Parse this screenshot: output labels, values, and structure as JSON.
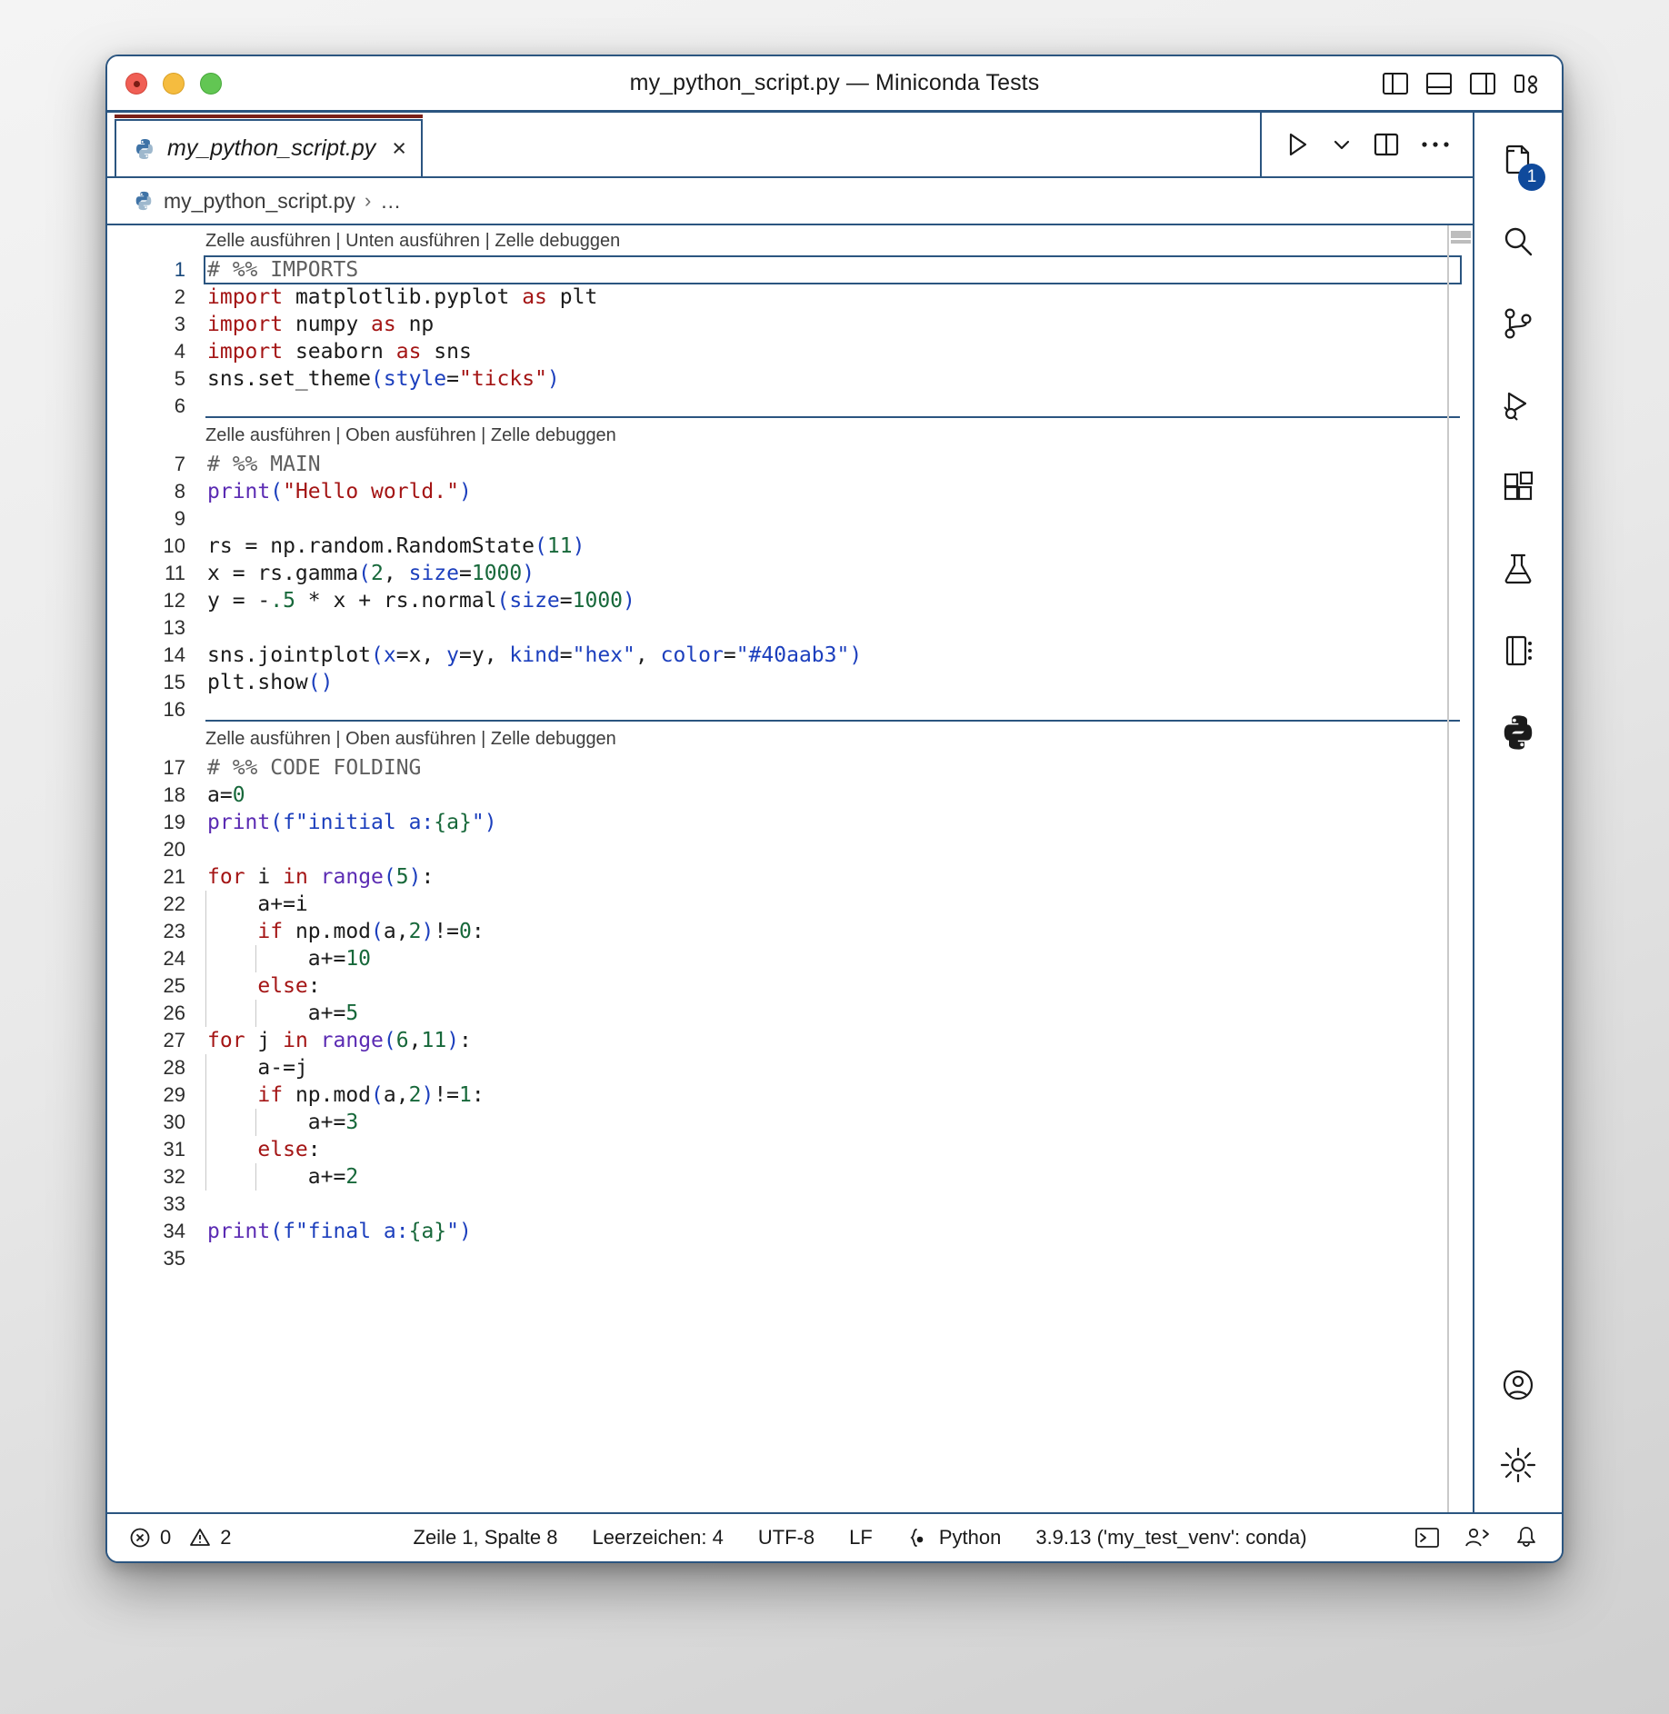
{
  "window": {
    "title": "my_python_script.py — Miniconda Tests",
    "traffic_lights": [
      "close-red",
      "minimize-yellow",
      "maximize-green"
    ],
    "layout_icons": [
      "toggle-primary-sidebar-icon",
      "toggle-panel-icon",
      "toggle-secondary-sidebar-icon",
      "customize-layout-icon"
    ]
  },
  "tab": {
    "label": "my_python_script.py",
    "icon": "python-file-icon",
    "close": "×"
  },
  "tab_actions": {
    "run": "run-python-file-icon",
    "run_dropdown": "chevron-down-icon",
    "split": "split-editor-right-icon",
    "more": "more-actions-icon"
  },
  "breadcrumb": {
    "icon": "python-file-icon",
    "file": "my_python_script.py",
    "separator": "›",
    "tail": "…"
  },
  "codelens": {
    "cell_top": "Zelle ausführen | Unten ausführen | Zelle debuggen",
    "cell_mid": "Zelle ausführen | Oben ausführen | Zelle debuggen",
    "cell_fold": "Zelle ausführen | Oben ausführen | Zelle debuggen"
  },
  "editor": {
    "active_line": 1,
    "lines": [
      {
        "n": 1,
        "tokens": [
          {
            "t": "# %% IMPORTS",
            "c": "cmt"
          }
        ]
      },
      {
        "n": 2,
        "tokens": [
          {
            "t": "import",
            "c": "kw"
          },
          {
            "t": " matplotlib.pyplot ",
            "c": "pl"
          },
          {
            "t": "as",
            "c": "kw"
          },
          {
            "t": " plt",
            "c": "pl"
          }
        ]
      },
      {
        "n": 3,
        "tokens": [
          {
            "t": "import",
            "c": "kw"
          },
          {
            "t": " numpy ",
            "c": "pl"
          },
          {
            "t": "as",
            "c": "kw"
          },
          {
            "t": " np",
            "c": "pl"
          }
        ]
      },
      {
        "n": 4,
        "tokens": [
          {
            "t": "import",
            "c": "kw"
          },
          {
            "t": " seaborn ",
            "c": "pl"
          },
          {
            "t": "as",
            "c": "kw"
          },
          {
            "t": " sns",
            "c": "pl"
          }
        ]
      },
      {
        "n": 5,
        "tokens": [
          {
            "t": "sns.set_theme",
            "c": "pl"
          },
          {
            "t": "(",
            "c": "par"
          },
          {
            "t": "style",
            "c": "par"
          },
          {
            "t": "=",
            "c": "pl"
          },
          {
            "t": "\"ticks\"",
            "c": "str"
          },
          {
            "t": ")",
            "c": "par"
          }
        ]
      },
      {
        "n": 6,
        "tokens": []
      },
      {
        "n": 7,
        "tokens": [
          {
            "t": "# %% MAIN",
            "c": "cmt"
          }
        ]
      },
      {
        "n": 8,
        "tokens": [
          {
            "t": "print",
            "c": "fn"
          },
          {
            "t": "(",
            "c": "par"
          },
          {
            "t": "\"Hello world.\"",
            "c": "str"
          },
          {
            "t": ")",
            "c": "par"
          }
        ]
      },
      {
        "n": 9,
        "tokens": []
      },
      {
        "n": 10,
        "tokens": [
          {
            "t": "rs = np.random.RandomState",
            "c": "pl"
          },
          {
            "t": "(",
            "c": "par"
          },
          {
            "t": "11",
            "c": "num"
          },
          {
            "t": ")",
            "c": "par"
          }
        ]
      },
      {
        "n": 11,
        "tokens": [
          {
            "t": "x = rs.gamma",
            "c": "pl"
          },
          {
            "t": "(",
            "c": "par"
          },
          {
            "t": "2",
            "c": "num"
          },
          {
            "t": ", ",
            "c": "pl"
          },
          {
            "t": "size",
            "c": "par"
          },
          {
            "t": "=",
            "c": "pl"
          },
          {
            "t": "1000",
            "c": "num"
          },
          {
            "t": ")",
            "c": "par"
          }
        ]
      },
      {
        "n": 12,
        "tokens": [
          {
            "t": "y = -",
            "c": "pl"
          },
          {
            "t": ".5",
            "c": "num"
          },
          {
            "t": " * x + rs.normal",
            "c": "pl"
          },
          {
            "t": "(",
            "c": "par"
          },
          {
            "t": "size",
            "c": "par"
          },
          {
            "t": "=",
            "c": "pl"
          },
          {
            "t": "1000",
            "c": "num"
          },
          {
            "t": ")",
            "c": "par"
          }
        ]
      },
      {
        "n": 13,
        "tokens": []
      },
      {
        "n": 14,
        "tokens": [
          {
            "t": "sns.jointplot",
            "c": "pl"
          },
          {
            "t": "(",
            "c": "par"
          },
          {
            "t": "x",
            "c": "par"
          },
          {
            "t": "=",
            "c": "pl"
          },
          {
            "t": "x, ",
            "c": "pl"
          },
          {
            "t": "y",
            "c": "par"
          },
          {
            "t": "=",
            "c": "pl"
          },
          {
            "t": "y, ",
            "c": "pl"
          },
          {
            "t": "kind",
            "c": "par"
          },
          {
            "t": "=",
            "c": "pl"
          },
          {
            "t": "\"hex\"",
            "c": "strb"
          },
          {
            "t": ", ",
            "c": "pl"
          },
          {
            "t": "color",
            "c": "par"
          },
          {
            "t": "=",
            "c": "pl"
          },
          {
            "t": "\"#40aab3\"",
            "c": "strb"
          },
          {
            "t": ")",
            "c": "par"
          }
        ]
      },
      {
        "n": 15,
        "tokens": [
          {
            "t": "plt.show",
            "c": "pl"
          },
          {
            "t": "()",
            "c": "par"
          }
        ]
      },
      {
        "n": 16,
        "tokens": []
      },
      {
        "n": 17,
        "tokens": [
          {
            "t": "# %% CODE FOLDING",
            "c": "cmt"
          }
        ]
      },
      {
        "n": 18,
        "tokens": [
          {
            "t": "a=",
            "c": "pl"
          },
          {
            "t": "0",
            "c": "num"
          }
        ]
      },
      {
        "n": 19,
        "tokens": [
          {
            "t": "print",
            "c": "fn"
          },
          {
            "t": "(",
            "c": "par"
          },
          {
            "t": "f\"initial a:",
            "c": "strb"
          },
          {
            "t": "{a}",
            "c": "num"
          },
          {
            "t": "\"",
            "c": "strb"
          },
          {
            "t": ")",
            "c": "par"
          }
        ]
      },
      {
        "n": 20,
        "tokens": []
      },
      {
        "n": 21,
        "tokens": [
          {
            "t": "for",
            "c": "kw"
          },
          {
            "t": " i ",
            "c": "pl"
          },
          {
            "t": "in",
            "c": "kw"
          },
          {
            "t": " ",
            "c": "pl"
          },
          {
            "t": "range",
            "c": "fn"
          },
          {
            "t": "(",
            "c": "par"
          },
          {
            "t": "5",
            "c": "num"
          },
          {
            "t": ")",
            "c": "par"
          },
          {
            "t": ":",
            "c": "pl"
          }
        ]
      },
      {
        "n": 22,
        "tokens": [
          {
            "t": "    a+=i",
            "c": "pl"
          }
        ]
      },
      {
        "n": 23,
        "tokens": [
          {
            "t": "    ",
            "c": "pl"
          },
          {
            "t": "if",
            "c": "kw"
          },
          {
            "t": " np.mod",
            "c": "pl"
          },
          {
            "t": "(",
            "c": "par"
          },
          {
            "t": "a,",
            "c": "pl"
          },
          {
            "t": "2",
            "c": "num"
          },
          {
            "t": ")",
            "c": "par"
          },
          {
            "t": "!=",
            "c": "pl"
          },
          {
            "t": "0",
            "c": "num"
          },
          {
            "t": ":",
            "c": "pl"
          }
        ]
      },
      {
        "n": 24,
        "tokens": [
          {
            "t": "        a+=",
            "c": "pl"
          },
          {
            "t": "10",
            "c": "num"
          }
        ]
      },
      {
        "n": 25,
        "tokens": [
          {
            "t": "    ",
            "c": "pl"
          },
          {
            "t": "else",
            "c": "kw"
          },
          {
            "t": ":",
            "c": "pl"
          }
        ]
      },
      {
        "n": 26,
        "tokens": [
          {
            "t": "        a+=",
            "c": "pl"
          },
          {
            "t": "5",
            "c": "num"
          }
        ]
      },
      {
        "n": 27,
        "tokens": [
          {
            "t": "for",
            "c": "kw"
          },
          {
            "t": " j ",
            "c": "pl"
          },
          {
            "t": "in",
            "c": "kw"
          },
          {
            "t": " ",
            "c": "pl"
          },
          {
            "t": "range",
            "c": "fn"
          },
          {
            "t": "(",
            "c": "par"
          },
          {
            "t": "6",
            "c": "num"
          },
          {
            "t": ",",
            "c": "pl"
          },
          {
            "t": "11",
            "c": "num"
          },
          {
            "t": ")",
            "c": "par"
          },
          {
            "t": ":",
            "c": "pl"
          }
        ]
      },
      {
        "n": 28,
        "tokens": [
          {
            "t": "    a-=j",
            "c": "pl"
          }
        ]
      },
      {
        "n": 29,
        "tokens": [
          {
            "t": "    ",
            "c": "pl"
          },
          {
            "t": "if",
            "c": "kw"
          },
          {
            "t": " np.mod",
            "c": "pl"
          },
          {
            "t": "(",
            "c": "par"
          },
          {
            "t": "a,",
            "c": "pl"
          },
          {
            "t": "2",
            "c": "num"
          },
          {
            "t": ")",
            "c": "par"
          },
          {
            "t": "!=",
            "c": "pl"
          },
          {
            "t": "1",
            "c": "num"
          },
          {
            "t": ":",
            "c": "pl"
          }
        ]
      },
      {
        "n": 30,
        "tokens": [
          {
            "t": "        a+=",
            "c": "pl"
          },
          {
            "t": "3",
            "c": "num"
          }
        ]
      },
      {
        "n": 31,
        "tokens": [
          {
            "t": "    ",
            "c": "pl"
          },
          {
            "t": "else",
            "c": "kw"
          },
          {
            "t": ":",
            "c": "pl"
          }
        ]
      },
      {
        "n": 32,
        "tokens": [
          {
            "t": "        a+=",
            "c": "pl"
          },
          {
            "t": "2",
            "c": "num"
          }
        ]
      },
      {
        "n": 33,
        "tokens": []
      },
      {
        "n": 34,
        "tokens": [
          {
            "t": "print",
            "c": "fn"
          },
          {
            "t": "(",
            "c": "par"
          },
          {
            "t": "f\"final a:",
            "c": "strb"
          },
          {
            "t": "{a}",
            "c": "num"
          },
          {
            "t": "\"",
            "c": "strb"
          },
          {
            "t": ")",
            "c": "par"
          }
        ]
      },
      {
        "n": 35,
        "tokens": []
      }
    ]
  },
  "activitybar": {
    "items": [
      {
        "icon": "explorer-files-icon",
        "badge": "1"
      },
      {
        "icon": "search-icon",
        "badge": ""
      },
      {
        "icon": "source-control-icon",
        "badge": ""
      },
      {
        "icon": "run-and-debug-icon",
        "badge": ""
      },
      {
        "icon": "extensions-icon",
        "badge": ""
      },
      {
        "icon": "testing-flask-icon",
        "badge": ""
      },
      {
        "icon": "jupyter-notebook-icon",
        "badge": ""
      },
      {
        "icon": "python-icon",
        "badge": ""
      }
    ],
    "bottom": [
      {
        "icon": "accounts-person-icon"
      },
      {
        "icon": "settings-gear-icon"
      }
    ]
  },
  "statusbar": {
    "errors_icon": "error-circle-icon",
    "errors": "0",
    "warnings_icon": "warning-triangle-icon",
    "warnings": "2",
    "position": "Zeile 1, Spalte 8",
    "indentation": "Leerzeichen: 4",
    "encoding": "UTF-8",
    "eol": "LF",
    "language_icon": "python-brackets-icon",
    "language": "Python",
    "interpreter": "3.9.13 ('my_test_venv': conda)",
    "terminal_icon": "open-terminal-icon",
    "remote_icon": "live-share-icon",
    "bell_icon": "notifications-bell-icon"
  },
  "colors": {
    "accent": "#2b5580",
    "badge": "#0f4a9c",
    "keyword": "#a41515",
    "function": "#5b2bb3",
    "number": "#17683a",
    "string": "#a41515",
    "fstring": "#1c3fbd",
    "comment": "#5f5f5f",
    "tab_top": "#7a2018"
  }
}
